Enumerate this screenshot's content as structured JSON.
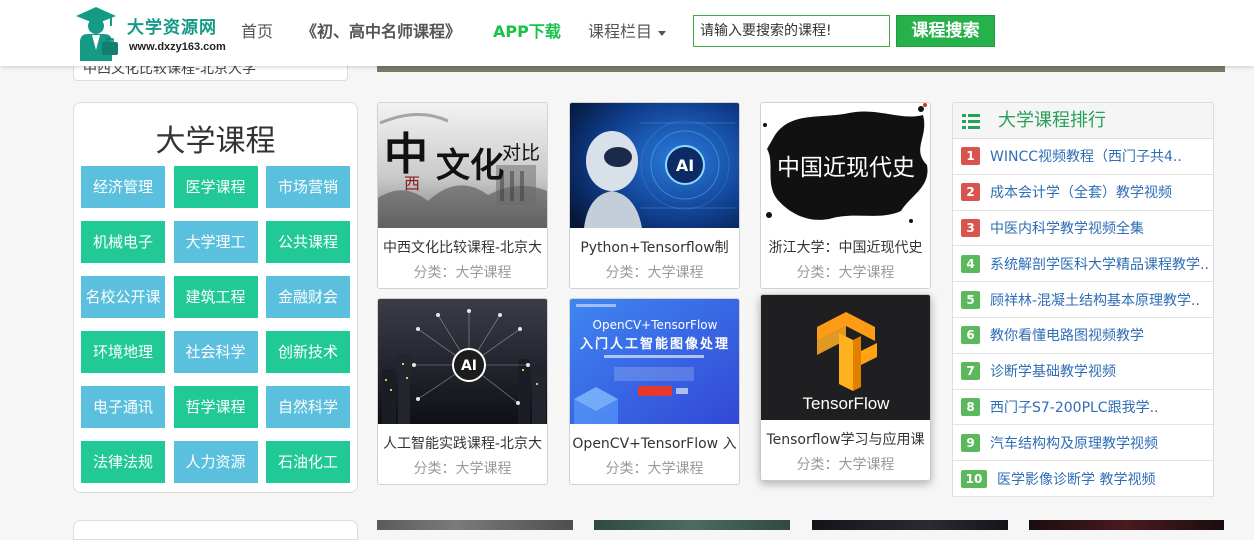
{
  "site": {
    "name": "大学资源网",
    "url": "www.dxzy163.com",
    "logo_icon": "graduate-logo-icon"
  },
  "nav": {
    "items": [
      {
        "label": "首页"
      },
      {
        "label": "《初、高中名师课程》"
      },
      {
        "label": "APP下载"
      },
      {
        "label": "课程栏目"
      }
    ],
    "dropdown_icon": "caret-down-icon"
  },
  "search": {
    "placeholder": "请输入要搜索的课程!",
    "value": "",
    "button_label": "课程搜索"
  },
  "previous_card": {
    "title": "中西文化比较课程-北京大学"
  },
  "categories": {
    "title": "大学课程",
    "items": [
      "经济管理",
      "医学课程",
      "市场营销",
      "机械电子",
      "大学理工",
      "公共课程",
      "名校公开课",
      "建筑工程",
      "金融财会",
      "环境地理",
      "社会科学",
      "创新技术",
      "电子通讯",
      "哲学课程",
      "自然科学",
      "法律法规",
      "人力资源",
      "石油化工"
    ]
  },
  "cards": [
    {
      "title": "中西文化比较课程-北京大",
      "category": "分类：大学课程",
      "image_text": [
        "中",
        "西",
        "文化",
        "对比"
      ]
    },
    {
      "title": "Python+Tensorflow制",
      "category": "分类：大学课程",
      "image_text": [
        "AI"
      ]
    },
    {
      "title": "浙江大学：中国近现代史",
      "category": "分类：大学课程",
      "image_text": [
        "中国近现代史"
      ]
    },
    {
      "title": "人工智能实践课程-北京大",
      "category": "分类：大学课程",
      "image_text": [
        "AI"
      ]
    },
    {
      "title": "OpenCV+TensorFlow 入",
      "category": "分类：大学课程",
      "image_text": [
        "OpenCV+TensorFlow",
        "入门人工智能图像处理"
      ]
    },
    {
      "title": "Tensorflow学习与应用课",
      "category": "分类：大学课程",
      "image_text": [
        "TensorFlow"
      ]
    }
  ],
  "ranking": {
    "title": "大学课程排行",
    "icon": "list-icon",
    "items": [
      {
        "rank": "1",
        "title": "WINCC视频教程（西门子共4.."
      },
      {
        "rank": "2",
        "title": "成本会计学（全套）教学视频"
      },
      {
        "rank": "3",
        "title": "中医内科学教学视频全集"
      },
      {
        "rank": "4",
        "title": "系统解剖学医科大学精品课程教学.."
      },
      {
        "rank": "5",
        "title": "顾祥林-混凝土结构基本原理教学.."
      },
      {
        "rank": "6",
        "title": "教你看懂电路图视频教学"
      },
      {
        "rank": "7",
        "title": "诊断学基础教学视频"
      },
      {
        "rank": "8",
        "title": "西门子S7-200PLC跟我学.."
      },
      {
        "rank": "9",
        "title": "汽车结构构及原理教学视频"
      },
      {
        "rank": "10",
        "title": "医学影像诊断学 教学视频"
      }
    ]
  },
  "colors": {
    "brand": "#159a86",
    "app_link": "#19c24a",
    "search_button": "#27b14a",
    "category_blue": "#5bc0de",
    "category_green": "#21c996",
    "rank_top3": "#d9534f",
    "rank_other": "#5cb85c",
    "link": "#2f6db5",
    "ranking_title": "#27a05b"
  }
}
